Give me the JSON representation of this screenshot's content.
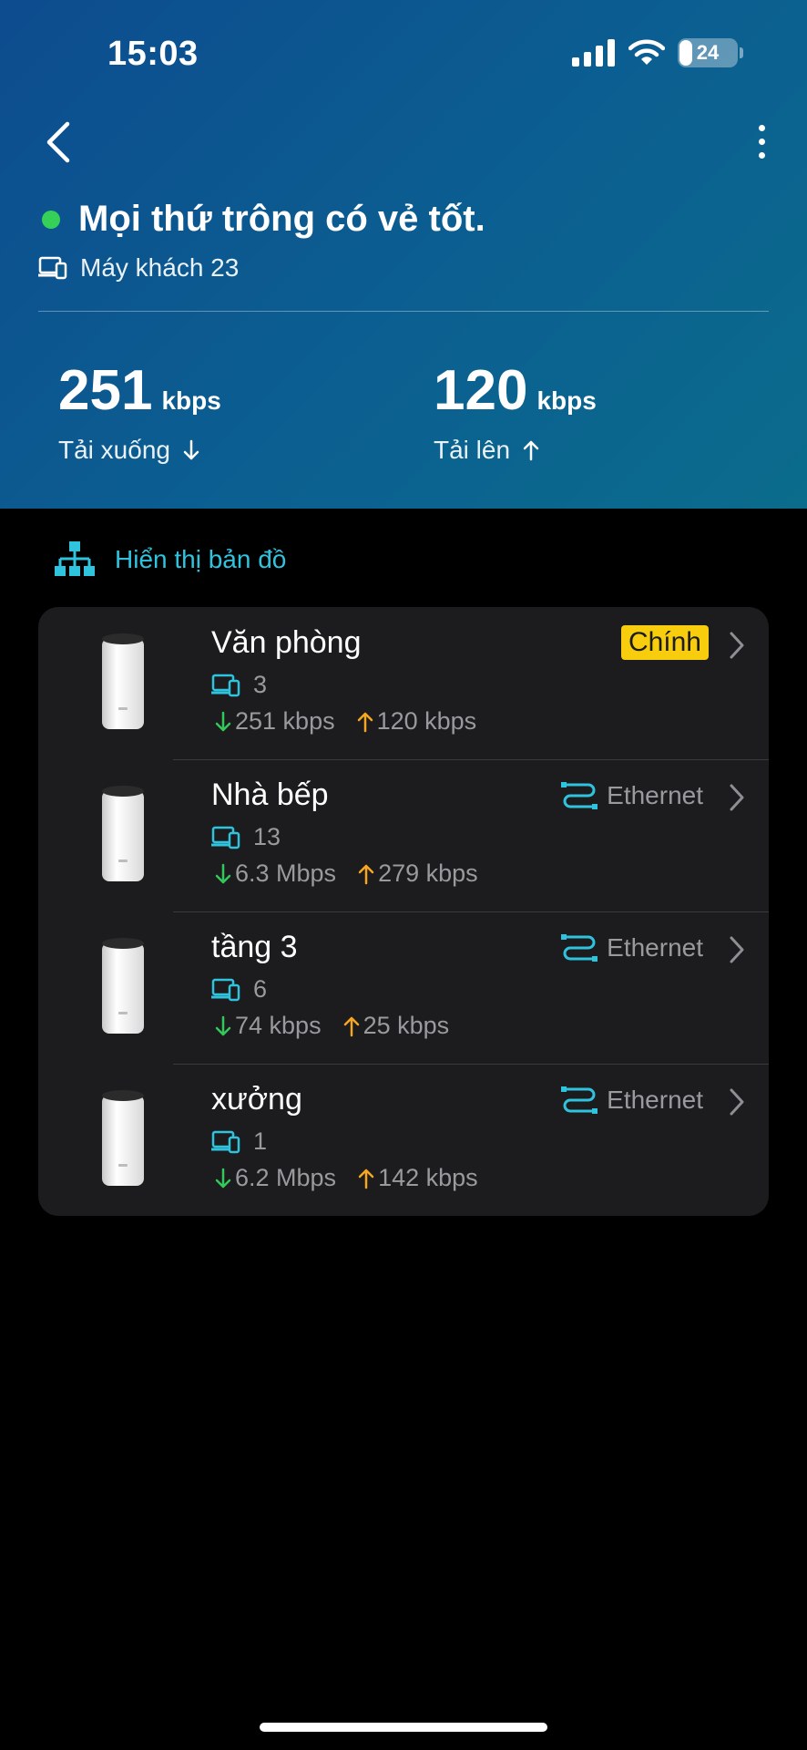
{
  "status_bar": {
    "time": "15:03",
    "battery": "24"
  },
  "header": {
    "health_text": "Mọi thứ trông có vẻ tốt.",
    "clients_label": "Máy khách 23",
    "download": {
      "value": "251",
      "unit": "kbps",
      "label": "Tải xuống"
    },
    "upload": {
      "value": "120",
      "unit": "kbps",
      "label": "Tải lên"
    }
  },
  "map_link": {
    "label": "Hiển thị bản đồ"
  },
  "devices": [
    {
      "name": "Văn phòng",
      "tag": "Chính",
      "clients": "3",
      "down": "251 kbps",
      "up": "120 kbps"
    },
    {
      "name": "Nhà bếp",
      "tag": "Ethernet",
      "clients": "13",
      "down": "6.3 Mbps",
      "up": "279 kbps"
    },
    {
      "name": "tầng 3",
      "tag": "Ethernet",
      "clients": "6",
      "down": "74 kbps",
      "up": "25 kbps"
    },
    {
      "name": "xưởng",
      "tag": "Ethernet",
      "clients": "1",
      "down": "6.2 Mbps",
      "up": "142 kbps"
    }
  ],
  "colors": {
    "accent": "#2fc3de",
    "main_badge": "#f8cd0e",
    "download_arrow": "#34c759",
    "upload_arrow": "#f5a623",
    "status_ok": "#34d058"
  }
}
